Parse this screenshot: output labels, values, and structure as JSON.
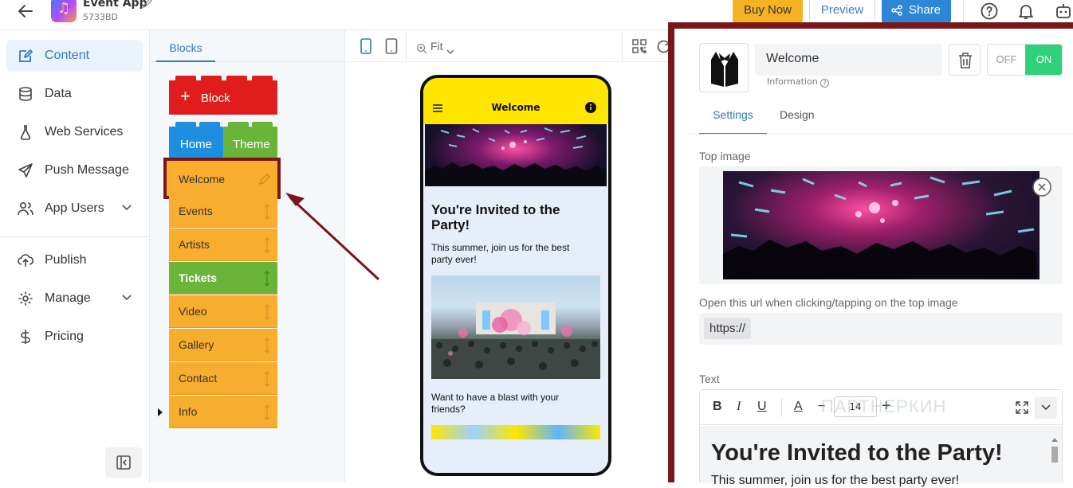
{
  "app": {
    "name": "Event App",
    "id": "5733BD"
  },
  "topbar": {
    "buy_label": "Buy Now",
    "preview_label": "Preview",
    "share_label": "Share"
  },
  "sidebar": {
    "items": [
      {
        "label": "Content",
        "icon": "edit-icon",
        "active": true
      },
      {
        "label": "Data",
        "icon": "database-icon"
      },
      {
        "label": "Web Services",
        "icon": "flask-icon"
      },
      {
        "label": "Push Message",
        "icon": "send-icon"
      },
      {
        "label": "App Users",
        "icon": "users-icon",
        "has_submenu": true
      },
      {
        "label": "Publish",
        "icon": "cloud-upload-icon"
      },
      {
        "label": "Manage",
        "icon": "gear-icon",
        "has_submenu": true
      },
      {
        "label": "Pricing",
        "icon": "dollar-icon"
      }
    ]
  },
  "blocks_panel": {
    "tab_label": "Blocks",
    "add_block_label": "Block",
    "home_label": "Home",
    "theme_label": "Theme",
    "items": [
      {
        "label": "Welcome",
        "selected": true
      },
      {
        "label": "Events"
      },
      {
        "label": "Artists"
      },
      {
        "label": "Tickets",
        "color": "#6ab43a"
      },
      {
        "label": "Video"
      },
      {
        "label": "Gallery"
      },
      {
        "label": "Contact"
      },
      {
        "label": "Info"
      }
    ]
  },
  "canvas": {
    "zoom_label": "Fit"
  },
  "phone": {
    "header_title": "Welcome",
    "headline": "You're Invited to the Party!",
    "intro": "This summer, join us for the best party ever!",
    "question": "Want to have a blast with your friends?"
  },
  "right_panel": {
    "block_name": "Welcome",
    "info_label": "Information",
    "toggle_off": "OFF",
    "toggle_on": "ON",
    "tabs": [
      "Settings",
      "Design"
    ],
    "top_image_label": "Top image",
    "url_label": "Open this url when clicking/tapping on the top image",
    "url_value": "https://",
    "text_label": "Text",
    "font_size": "14",
    "editor_heading": "You're Invited to the Party!",
    "editor_paragraph": "This summer, join us for the best party ever!"
  },
  "watermark": "ПАРТНЕРКИН",
  "colors": {
    "accent": "#2f78c4",
    "buy": "#f5b324",
    "share": "#2e86d6",
    "block_orange": "#f9ad2e",
    "block_green": "#6ab43a",
    "block_red": "#e01c1c",
    "home_blue": "#1e8fe0",
    "toggle_on": "#2fd27a",
    "highlight": "#7b1616",
    "phone_header": "#ffe600"
  }
}
